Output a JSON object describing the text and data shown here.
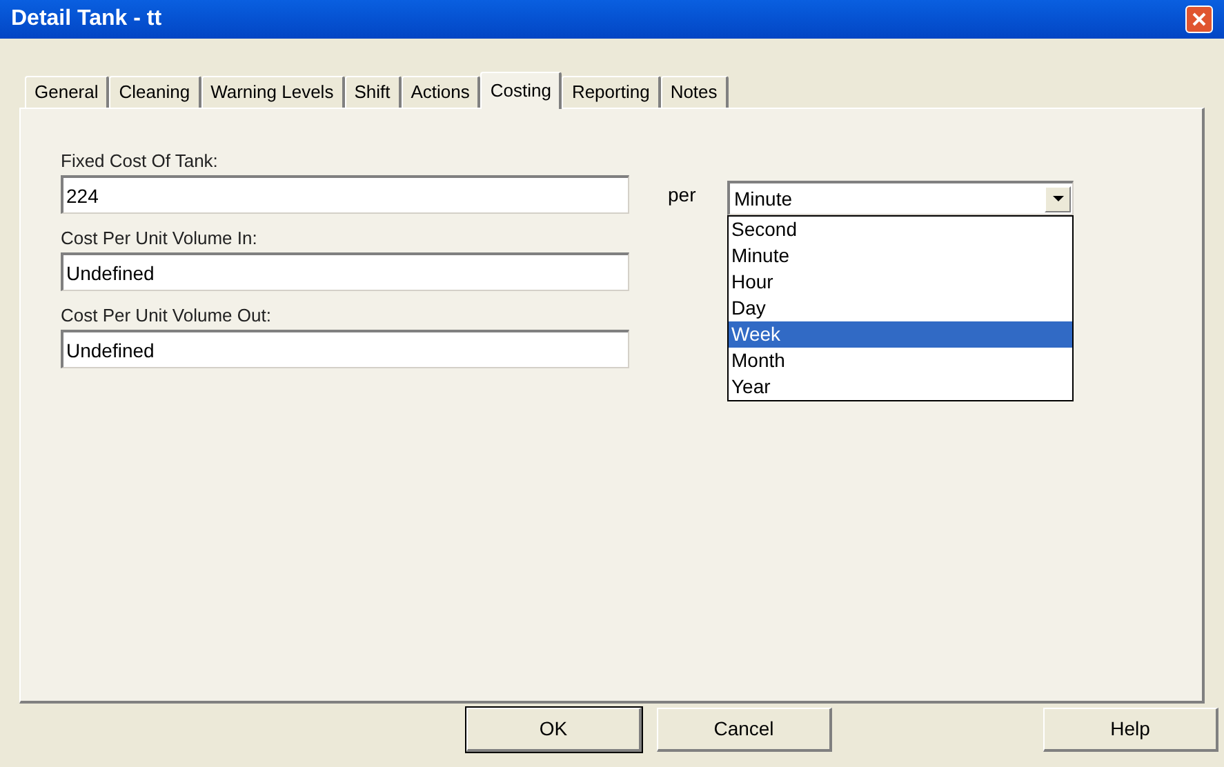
{
  "window": {
    "title": "Detail Tank - tt"
  },
  "tabs": [
    {
      "label": "General",
      "selected": false
    },
    {
      "label": "Cleaning",
      "selected": false
    },
    {
      "label": "Warning Levels",
      "selected": false
    },
    {
      "label": "Shift",
      "selected": false
    },
    {
      "label": "Actions",
      "selected": false
    },
    {
      "label": "Costing",
      "selected": true
    },
    {
      "label": "Reporting",
      "selected": false
    },
    {
      "label": "Notes",
      "selected": false
    }
  ],
  "fields": [
    {
      "label": "Fixed Cost Of Tank:",
      "value": "224"
    },
    {
      "label": "Cost Per Unit Volume In:",
      "value": "Undefined"
    },
    {
      "label": "Cost Per Unit Volume Out:",
      "value": "Undefined"
    }
  ],
  "per_label": "per",
  "period_dropdown": {
    "value": "Minute",
    "options": [
      {
        "label": "Second",
        "highlighted": false
      },
      {
        "label": "Minute",
        "highlighted": false
      },
      {
        "label": "Hour",
        "highlighted": false
      },
      {
        "label": "Day",
        "highlighted": false
      },
      {
        "label": "Week",
        "highlighted": true
      },
      {
        "label": "Month",
        "highlighted": false
      },
      {
        "label": "Year",
        "highlighted": false
      }
    ]
  },
  "buttons": [
    {
      "label": "OK",
      "default": true
    },
    {
      "label": "Cancel",
      "default": false
    },
    {
      "label": "Help",
      "default": false
    }
  ]
}
